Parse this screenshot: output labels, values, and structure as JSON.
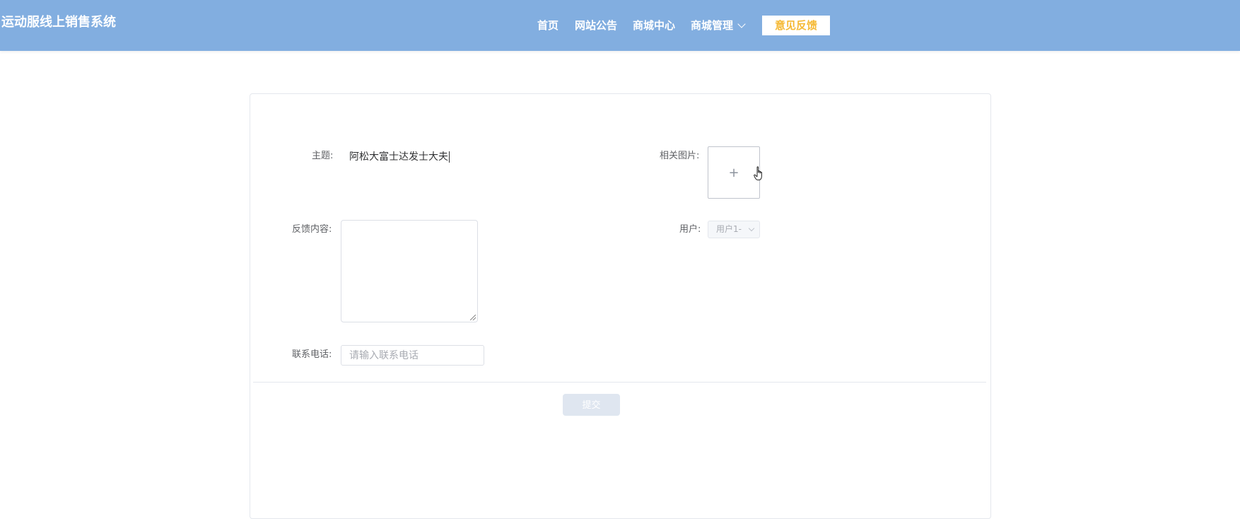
{
  "header": {
    "brand": "运动服线上销售系统",
    "nav": [
      {
        "label": "首页"
      },
      {
        "label": "网站公告"
      },
      {
        "label": "商城中心"
      },
      {
        "label": "商城管理",
        "has_dropdown": true
      }
    ],
    "feedback_label": "意见反馈",
    "colors": {
      "bar": "#82aee0",
      "feedback_text": "#f5b935"
    }
  },
  "form": {
    "subject_label": "主题:",
    "subject_value": "阿松大富士达发士大夫",
    "content_label": "反馈内容:",
    "content_value": "",
    "phone_label": "联系电话:",
    "phone_placeholder": "请输入联系电话",
    "image_label": "相关图片:",
    "image_upload_icon": "plus-icon",
    "image_upload_glyph": "+",
    "user_label": "用户:",
    "user_value": "用户1-",
    "submit_label": "提交"
  }
}
